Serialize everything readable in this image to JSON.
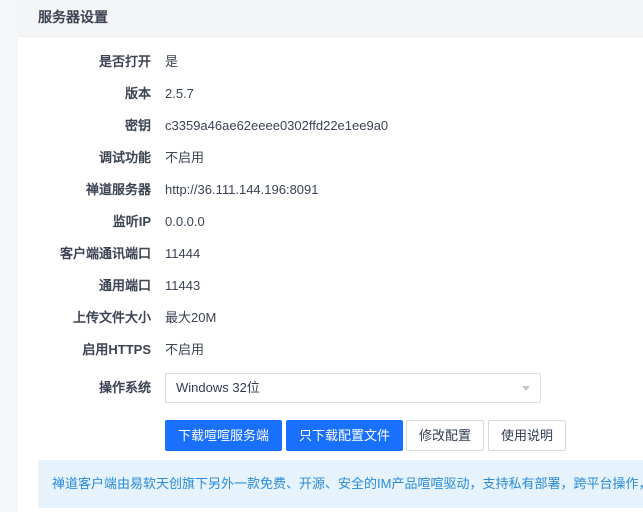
{
  "panel": {
    "title": "服务器设置"
  },
  "fields": [
    {
      "label": "是否打开",
      "value": "是"
    },
    {
      "label": "版本",
      "value": "2.5.7"
    },
    {
      "label": "密钥",
      "value": "c3359a46ae62eeee0302ffd22e1ee9a0"
    },
    {
      "label": "调试功能",
      "value": "不启用"
    },
    {
      "label": "禅道服务器",
      "value": "http://36.111.144.196:8091"
    },
    {
      "label": "监听IP",
      "value": "0.0.0.0"
    },
    {
      "label": "客户端通讯端口",
      "value": "11444"
    },
    {
      "label": "通用端口",
      "value": "11443"
    },
    {
      "label": "上传文件大小",
      "value": "最大20M"
    },
    {
      "label": "启用HTTPS",
      "value": "不启用"
    }
  ],
  "os": {
    "label": "操作系统",
    "selected": "Windows 32位"
  },
  "buttons": {
    "download_server": "下载喧喧服务端",
    "download_config": "只下载配置文件",
    "edit_config": "修改配置",
    "help": "使用说明"
  },
  "info": {
    "text": "禅道客户端由易软天创旗下另外一款免费、开源、安全的IM产品喧喧驱动，支持私有部署，跨平台操作，"
  },
  "colors": {
    "primary": "#1970fc",
    "info_bg": "#e6f3fc",
    "info_text": "#2a8ad6"
  },
  "icons": {
    "select_caret": "chevron-down-icon"
  }
}
